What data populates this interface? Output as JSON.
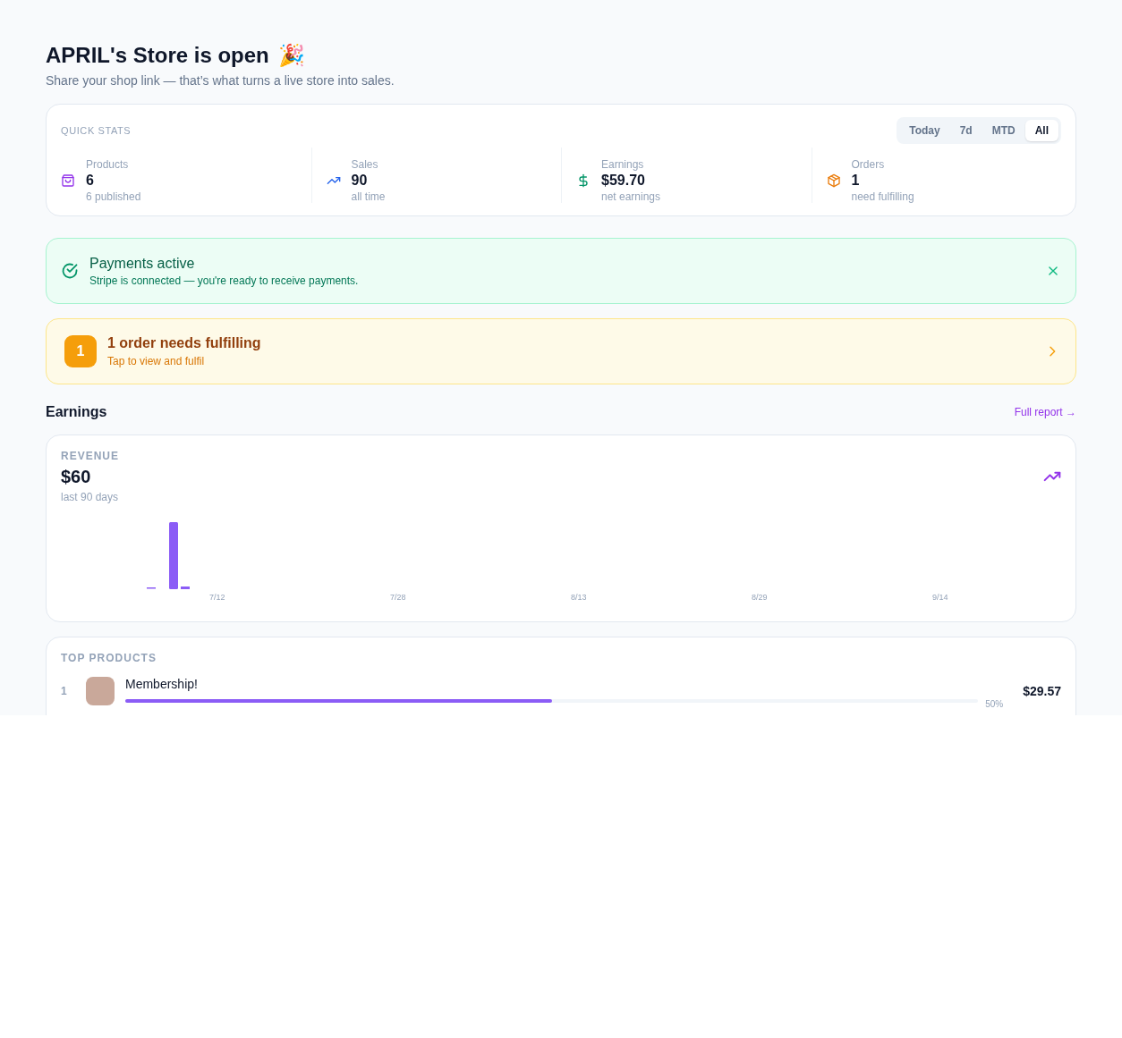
{
  "header": {
    "title": "APRIL's Store is open",
    "emoji": "🎉",
    "subtitle": "Share your shop link — that’s what turns a live store into sales."
  },
  "quick_stats": {
    "title": "QUICK STATS",
    "ranges": [
      {
        "label": "Today",
        "selected": false
      },
      {
        "label": "7d",
        "selected": false
      },
      {
        "label": "MTD",
        "selected": false
      },
      {
        "label": "All",
        "selected": true
      }
    ],
    "stats": [
      {
        "kind": "products",
        "label": "Products",
        "value": "6",
        "note": "6 published"
      },
      {
        "kind": "sales",
        "label": "Sales",
        "value": "90",
        "note": "all time"
      },
      {
        "kind": "earnings",
        "label": "Earnings",
        "value": "$59.70",
        "note": "net earnings"
      },
      {
        "kind": "orders",
        "label": "Orders",
        "value": "1",
        "note": "need fulfilling"
      }
    ]
  },
  "payments_banner": {
    "title": "Payments active",
    "message": "Stripe is connected — you're ready to receive payments."
  },
  "orders_banner": {
    "count": "1",
    "title": "1 order needs fulfilling",
    "message": "Tap to view and fulfil"
  },
  "earnings": {
    "heading": "Earnings",
    "link": "Full report →",
    "card_title": "REVENUE",
    "total": "$60",
    "period": "last 90 days",
    "x_labels": [
      "7/12",
      "7/28",
      "8/13",
      "8/29",
      "9/14"
    ]
  },
  "top_products": {
    "title": "TOP PRODUCTS",
    "items": [
      {
        "rank": "1",
        "name": "Membership!",
        "level": 0.5,
        "share": "50%",
        "amount": "$29.57"
      }
    ]
  }
}
